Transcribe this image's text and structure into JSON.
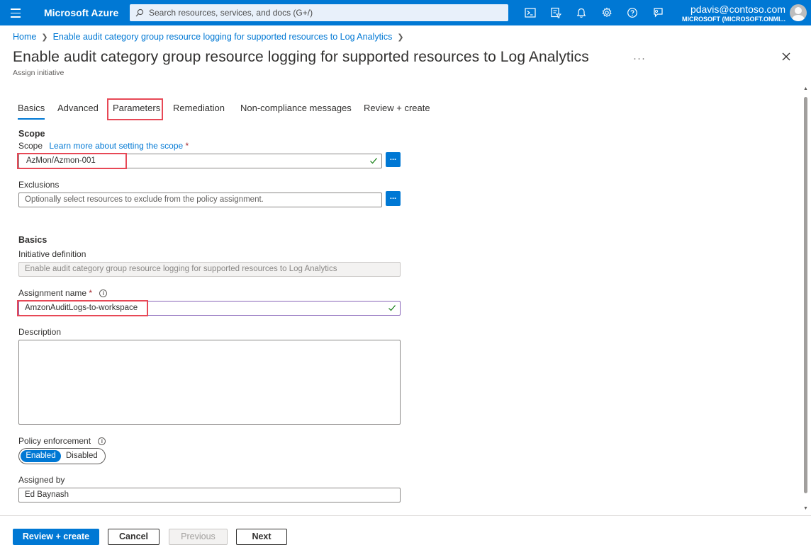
{
  "topbar": {
    "brand": "Microsoft Azure",
    "search_placeholder": "Search resources, services, and docs (G+/)",
    "user_name": "pdavis@contoso.com",
    "user_tenant": "MICROSOFT (MICROSOFT.ONMI...",
    "icons": [
      "cloud-shell-icon",
      "directory-filter-icon",
      "notifications-icon",
      "settings-icon",
      "help-icon",
      "feedback-icon"
    ]
  },
  "breadcrumb": {
    "home": "Home",
    "current": "Enable audit category group resource logging for supported resources to Log Analytics"
  },
  "page": {
    "title": "Enable audit category group resource logging for supported resources to Log Analytics",
    "subtitle": "Assign initiative",
    "more": "···"
  },
  "tabs": [
    {
      "label": "Basics",
      "active": true
    },
    {
      "label": "Advanced"
    },
    {
      "label": "Parameters",
      "highlighted": true
    },
    {
      "label": "Remediation"
    },
    {
      "label": "Non-compliance messages"
    },
    {
      "label": "Review + create"
    }
  ],
  "scope": {
    "section": "Scope",
    "label": "Scope",
    "learn_more": "Learn more about setting the scope",
    "required": "*",
    "value": "AzMon/Azmon-001",
    "browse": "...",
    "exclusions_label": "Exclusions",
    "exclusions_placeholder": "Optionally select resources to exclude from the policy assignment."
  },
  "basics": {
    "section": "Basics",
    "initiative_label": "Initiative definition",
    "initiative_value": "Enable audit category group resource logging for supported resources to Log Analytics",
    "assignment_label": "Assignment name",
    "assignment_required": "*",
    "assignment_value": "AmzonAuditLogs-to-workspace",
    "description_label": "Description",
    "enforcement_label": "Policy enforcement",
    "enforcement_on": "Enabled",
    "enforcement_off": "Disabled",
    "assigned_by_label": "Assigned by",
    "assigned_by_value": "Ed Baynash"
  },
  "footer": {
    "review": "Review + create",
    "cancel": "Cancel",
    "previous": "Previous",
    "next": "Next"
  },
  "colors": {
    "accent": "#0078d4",
    "highlight": "#e74856",
    "valid": "#107c10"
  }
}
